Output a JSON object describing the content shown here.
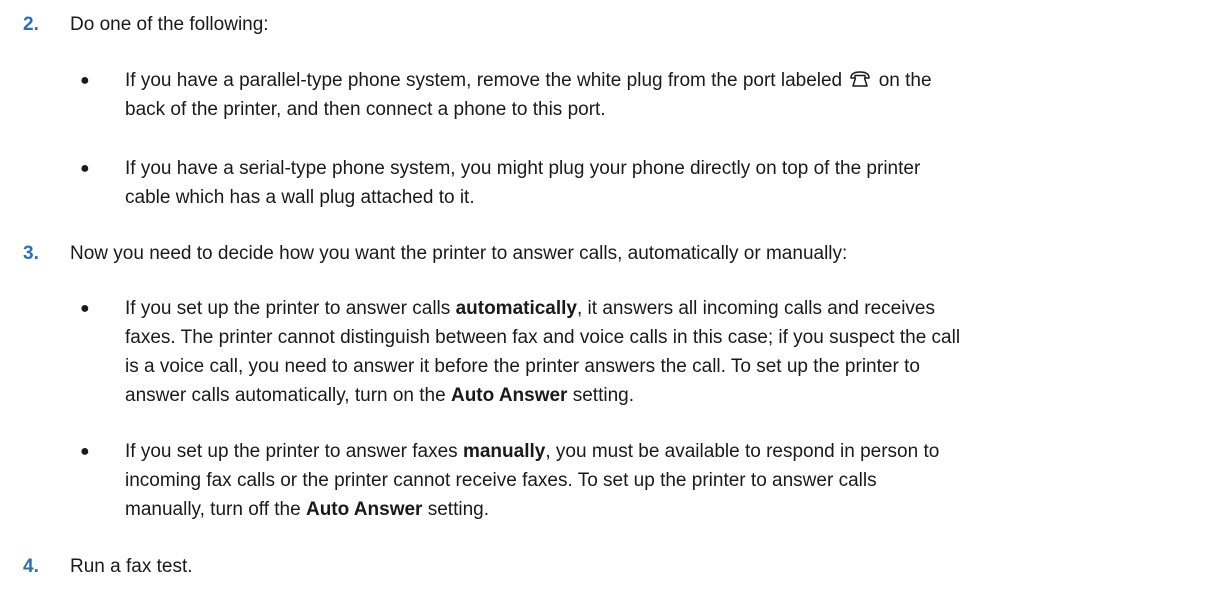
{
  "bullet_glyph": "●",
  "steps": [
    {
      "number": "2.",
      "text": "Do one of the following:"
    },
    {
      "number": "3.",
      "text": "Now you need to decide how you want the printer to answer calls, automatically or manually:"
    },
    {
      "number": "4.",
      "text": "Run a fax test."
    }
  ],
  "bullets": {
    "parallel": {
      "line1_before_icon": "If you have a parallel-type phone system, remove the white plug from the port labeled",
      "line1_after_icon": "on the",
      "icon": "telephone-icon",
      "line2": "back of the printer, and then connect a phone to this port."
    },
    "serial": {
      "line1": "If you have a serial-type phone system, you might plug your phone directly on top of the printer",
      "line2": "cable which has a wall plug attached to it."
    },
    "automatic": {
      "line1_before": "If you set up the printer to answer calls",
      "line1_bold": "automatically",
      "line1_after": ", it answers all incoming calls and receives",
      "line2": "faxes. The printer cannot distinguish between fax and voice calls in this case; if you suspect the call",
      "line3": "is a voice call, you need to answer it before the printer answers the call. To set up the printer to",
      "line4_before": "answer calls automatically, turn on the",
      "line4_bold": "Auto Answer",
      "line4_after": "setting."
    },
    "manual": {
      "line1_before": "If you set up the printer to answer faxes",
      "line1_bold": "manually",
      "line1_after": ", you must be available to respond in person to",
      "line2": "incoming fax calls or the printer cannot receive faxes. To set up the printer to answer calls",
      "line3_before": "manually, turn off the",
      "line3_bold": "Auto Answer",
      "line3_after": "setting."
    }
  },
  "colors": {
    "step_number": "#2d6fb7",
    "text": "#1a1a1a"
  }
}
